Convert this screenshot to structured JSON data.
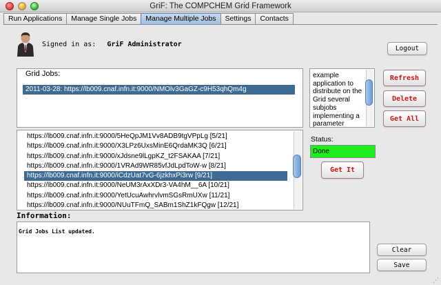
{
  "window": {
    "title": "GriF: The COMPCHEM Grid Framework"
  },
  "tabs": [
    {
      "label": "Run Applications",
      "active": false
    },
    {
      "label": "Manage Single Jobs",
      "active": false
    },
    {
      "label": "Manage Multiple Jobs",
      "active": true
    },
    {
      "label": "Settings",
      "active": false
    },
    {
      "label": "Contacts",
      "active": false
    }
  ],
  "user": {
    "signed_in_label": "Signed in as:",
    "name": "GriF Administrator"
  },
  "buttons": {
    "logout": "Logout",
    "refresh": "Refresh",
    "delete": "Delete",
    "get_all": "Get All",
    "get_it": "Get It",
    "clear": "Clear",
    "save": "Save"
  },
  "grid_jobs": {
    "label": "Grid Jobs:",
    "selected": "2011-03-28: https://lb009.cnaf.infn.it:9000/NMOlv3GaGZ-c9H53qhQm4g"
  },
  "description": "example application to distribute on the Grid several subjobs implementing a parameter",
  "subjobs": {
    "items": [
      "https://lb009.cnaf.infn.it:9000/5HeQpJM1Vv8ADB9tgVPpLg [5/21]",
      "https://lb009.cnaf.infn.it:9000/X3LPz6UxsMinE6QrdaMK3Q [6/21]",
      "https://lb009.cnaf.infn.it:9000/xJdsne9lLgpKZ_t2FSAKAA [7/21]",
      "https://lb009.cnaf.infn.it:9000/1VRAd9WR85vfJdLpdToW-w [8/21]",
      "https://lb009.cnaf.infn.it:9000/iCdzUat7vG-6jzkhxPi3rw [9/21]",
      "https://lb009.cnaf.infn.it:9000/NeUM3rAxXDr3-VA4hM__6A [10/21]",
      "https://lb009.cnaf.infn.it:9000/YetUcuAwhrvlvmSGsRmUXw [11/21]",
      "https://lb009.cnaf.infn.it:9000/NUuTFmQ_SABm1ShZ1kFQgw [12/21]"
    ],
    "selected_index": 4
  },
  "status": {
    "label": "Status:",
    "value": "Done",
    "color": "#1dee1d"
  },
  "information": {
    "label": "Information:",
    "text": "Grid Jobs List updated."
  },
  "colors": {
    "selection": "#3f6a91",
    "accent_button_text": "#c41818"
  }
}
